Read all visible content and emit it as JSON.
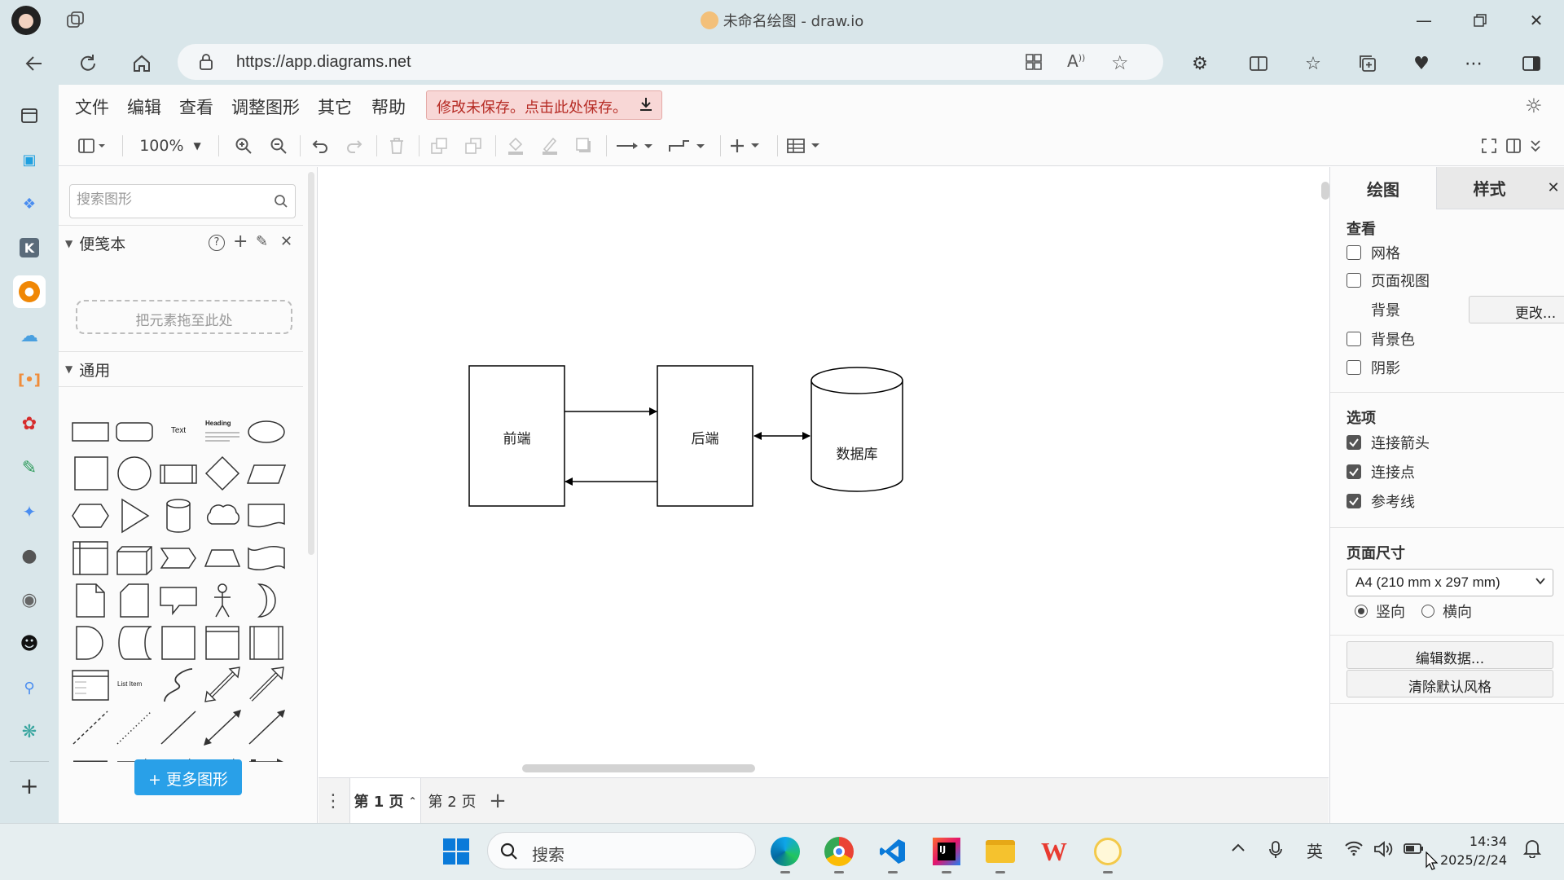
{
  "window": {
    "title": "未命名绘图 - draw.io",
    "url": "https://app.diagrams.net"
  },
  "menu": {
    "items": [
      "文件",
      "编辑",
      "查看",
      "调整图形",
      "其它",
      "帮助"
    ],
    "unsaved_notice": "修改未保存。点击此处保存。"
  },
  "toolbar": {
    "zoom": "100%"
  },
  "left_panel": {
    "search_placeholder": "搜索图形",
    "scratchpad_title": "便笺本",
    "dropzone_text": "把元素拖至此处",
    "general_title": "通用",
    "shape_text_label": "Text",
    "shape_heading_label": "Heading",
    "shape_list_item_label": "List Item",
    "more_shapes": "+ 更多图形"
  },
  "diagram": {
    "nodes": [
      {
        "id": "frontend",
        "label": "前端",
        "shape": "rectangle"
      },
      {
        "id": "backend",
        "label": "后端",
        "shape": "rectangle"
      },
      {
        "id": "database",
        "label": "数据库",
        "shape": "cylinder"
      }
    ],
    "edges": [
      {
        "from": "frontend",
        "to": "backend",
        "arrow": "end"
      },
      {
        "from": "backend",
        "to": "frontend",
        "arrow": "end"
      },
      {
        "from": "backend",
        "to": "database",
        "arrow": "both"
      }
    ]
  },
  "pages": {
    "tabs": [
      "第 1 页",
      "第 2 页"
    ],
    "active": 0
  },
  "right_panel": {
    "tabs": [
      "绘图",
      "样式"
    ],
    "view_section": "查看",
    "grid": {
      "label": "网格",
      "checked": false
    },
    "page_view": {
      "label": "页面视图",
      "checked": false
    },
    "background_label": "背景",
    "change_button": "更改...",
    "background_color": {
      "label": "背景色",
      "checked": false
    },
    "shadow": {
      "label": "阴影",
      "checked": false
    },
    "options_section": "选项",
    "connection_arrows": {
      "label": "连接箭头",
      "checked": true
    },
    "connection_points": {
      "label": "连接点",
      "checked": true
    },
    "guides": {
      "label": "参考线",
      "checked": true
    },
    "page_size_section": "页面尺寸",
    "page_size_value": "A4 (210 mm x 297 mm)",
    "portrait": "竖向",
    "landscape": "横向",
    "edit_data_button": "编辑数据...",
    "clear_style_button": "清除默认风格"
  },
  "taskbar": {
    "search_placeholder": "搜索",
    "ime": "英",
    "time": "14:34",
    "date": "2025/2/24"
  },
  "colors": {
    "accent": "#29a0e8",
    "unsaved_bg": "#f8d7d6",
    "unsaved_text": "#b62b24",
    "chrome_bg": "#d9e6ea"
  }
}
